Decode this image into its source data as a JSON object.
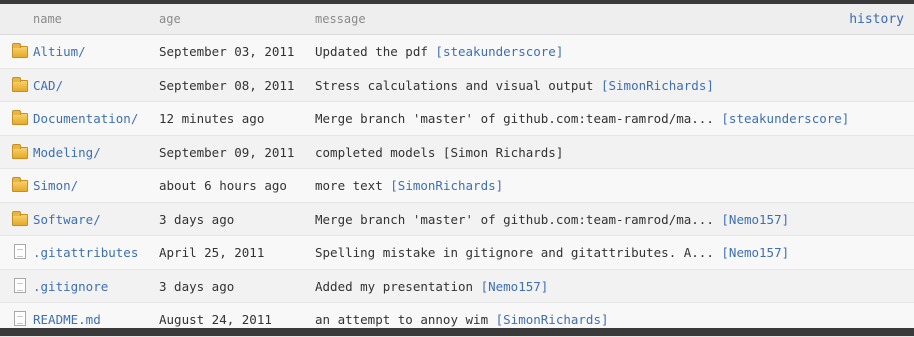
{
  "header": {
    "name": "name",
    "age": "age",
    "message": "message",
    "history": "history"
  },
  "rows": [
    {
      "type": "folder",
      "name": "Altium/",
      "age": "September 03, 2011",
      "message": "Updated the pdf ",
      "author": "[steakunderscore]"
    },
    {
      "type": "folder",
      "name": "CAD/",
      "age": "September 08, 2011",
      "message": "Stress calculations and visual output ",
      "author": "[SimonRichards]"
    },
    {
      "type": "folder",
      "name": "Documentation/",
      "age": "12 minutes ago",
      "message": "Merge branch 'master' of github.com:team-ramrod/ma... ",
      "author": "[steakunderscore]"
    },
    {
      "type": "folder",
      "name": "Modeling/",
      "age": "September 09, 2011",
      "message": "completed models [Simon Richards]",
      "author": ""
    },
    {
      "type": "folder",
      "name": "Simon/",
      "age": "about 6 hours ago",
      "message": "more text ",
      "author": "[SimonRichards]"
    },
    {
      "type": "folder",
      "name": "Software/",
      "age": "3 days ago",
      "message": "Merge branch 'master' of github.com:team-ramrod/ma... ",
      "author": "[Nemo157]"
    },
    {
      "type": "file",
      "name": ".gitattributes",
      "age": "April 25, 2011",
      "message": "Spelling mistake in gitignore and gitattributes. A... ",
      "author": "[Nemo157]"
    },
    {
      "type": "file",
      "name": ".gitignore",
      "age": "3 days ago",
      "message": "Added my presentation ",
      "author": "[Nemo157]"
    },
    {
      "type": "file",
      "name": "README.md",
      "age": "August 24, 2011",
      "message": "an attempt to annoy wim ",
      "author": "[SimonRichards]"
    }
  ]
}
